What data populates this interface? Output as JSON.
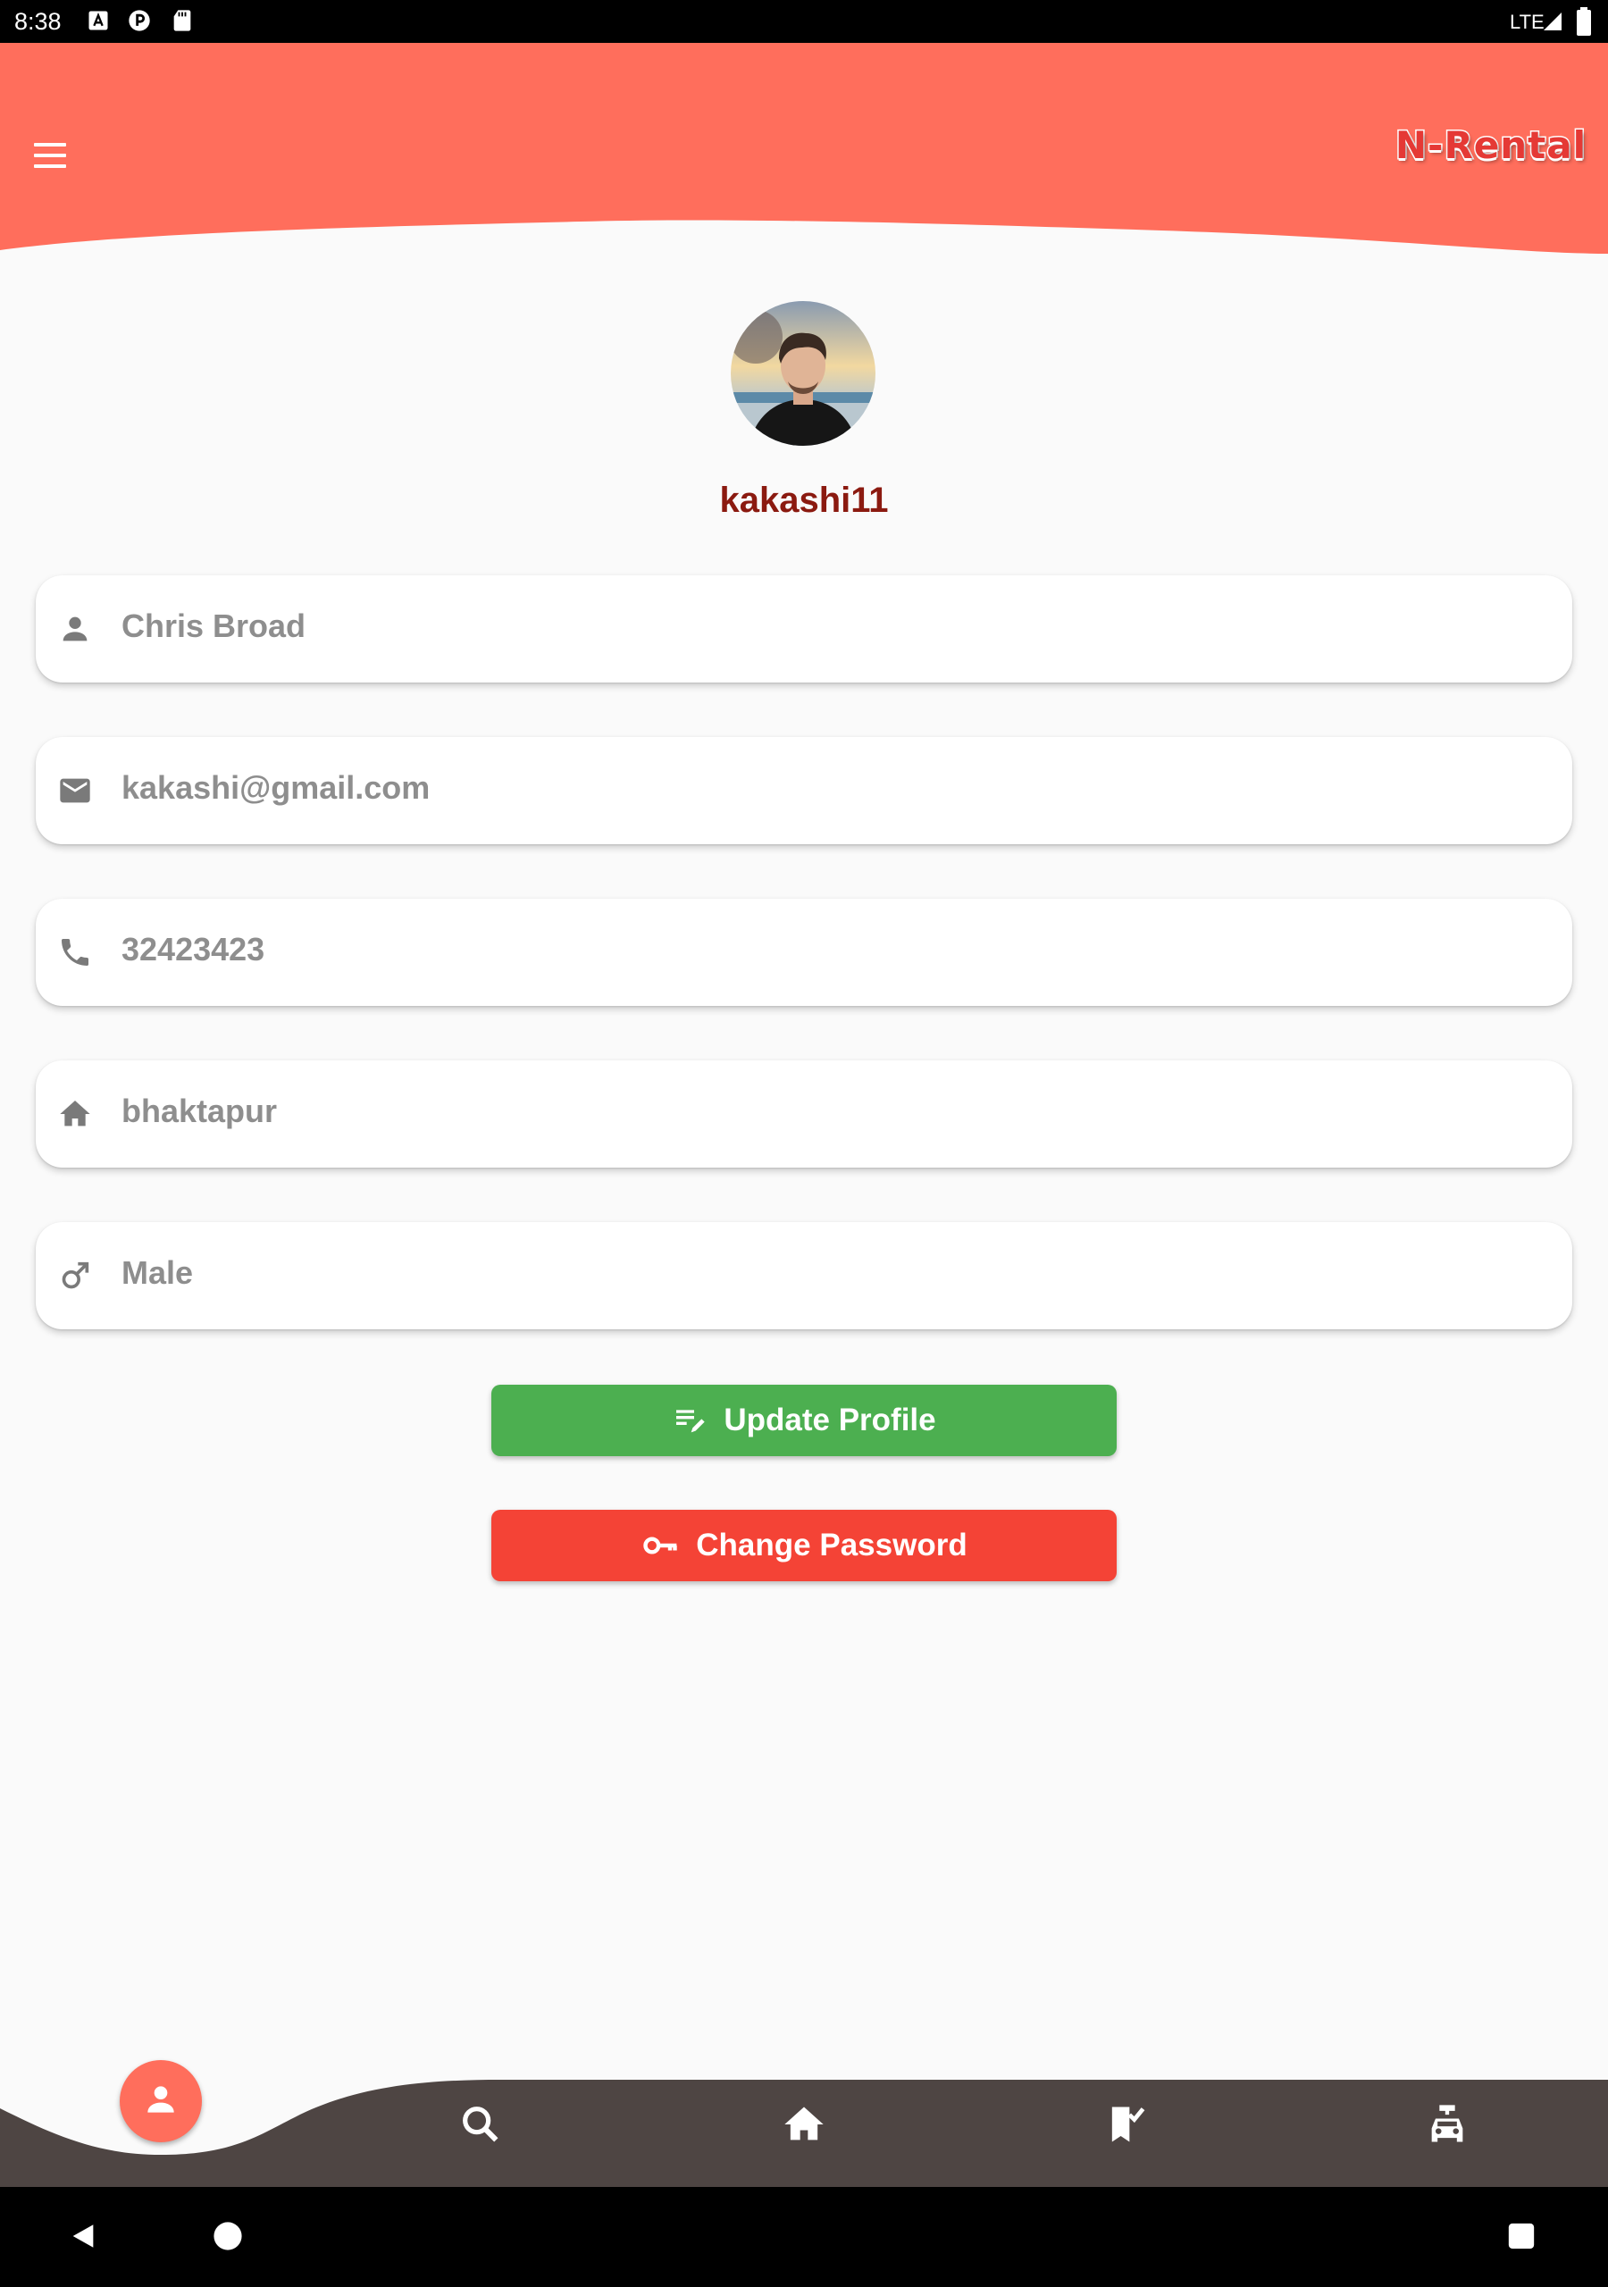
{
  "status_bar": {
    "time": "8:38",
    "network": "LTE"
  },
  "header": {
    "logo_text": "N-Rental",
    "menu_icon": "menu-icon"
  },
  "profile": {
    "avatar": "profile-photo",
    "username": "kakashi11",
    "fields": [
      {
        "icon": "person-icon",
        "value": "Chris Broad"
      },
      {
        "icon": "email-icon",
        "value": "kakashi@gmail.com"
      },
      {
        "icon": "phone-icon",
        "value": "32423423"
      },
      {
        "icon": "home-icon",
        "value": "bhaktapur"
      },
      {
        "icon": "male-icon",
        "value": "Male"
      }
    ]
  },
  "actions": {
    "update_label": "Update Profile",
    "change_password_label": "Change Password"
  },
  "bottom_nav": [
    {
      "icon": "person-icon",
      "active": true
    },
    {
      "icon": "search-icon",
      "active": false
    },
    {
      "icon": "home-icon",
      "active": false
    },
    {
      "icon": "bookmark-check-icon",
      "active": false
    },
    {
      "icon": "car-rental-icon",
      "active": false
    }
  ],
  "colors": {
    "header": "#ff6e5c",
    "username": "#8b1a10",
    "update_button": "#4caf50",
    "change_password_button": "#f44336",
    "bottom_bar": "#4e4543"
  }
}
